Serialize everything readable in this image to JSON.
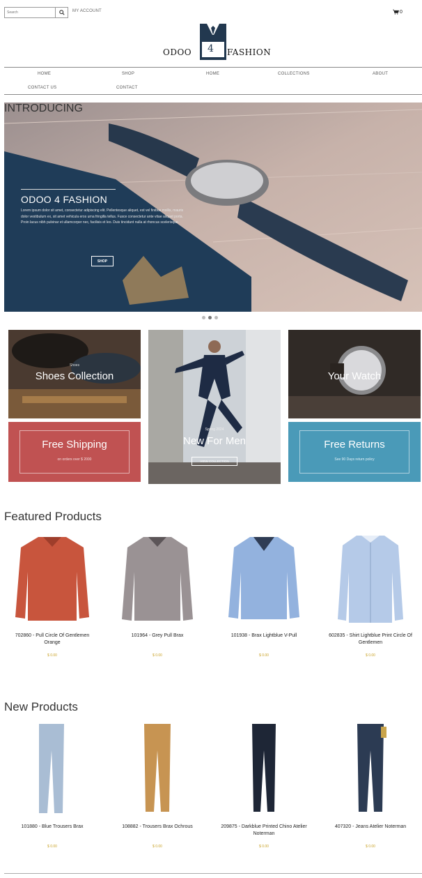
{
  "header": {
    "search_placeholder": "Search",
    "account_label": "MY ACCOUNT",
    "cart_count": "0"
  },
  "logo": {
    "left": "ODOO",
    "middle": "4",
    "right": "FASHION"
  },
  "nav": {
    "items": [
      "HOME",
      "SHOP",
      "HOME",
      "COLLECTIONS",
      "ABOUT",
      "CONTACT US",
      "CONTACT"
    ]
  },
  "hero": {
    "intro": "INTRODUCING",
    "title": "ODOO 4 FASHION",
    "body": "Lorem ipsum dolor sit amet, consectetur adipiscing elit. Pellentesque aliquet, est vel finibus mollis, mauris dolor vestibulum ex, sit amet vehicula eros urna fringilla tellus. Fusce consectetur ante vitae aliquet porta. Proin lacus nibh pulvinar et ullamcorper nec, facilisis et leo. Duis tincidunt nulla at rhoncus scelerisque.",
    "button": "SHOP"
  },
  "tiles": {
    "shoes": {
      "small": "Shoes",
      "title": "Shoes Collection"
    },
    "men": {
      "small": "Spring 2024",
      "title": "New For Men",
      "button": "VIEW COLLECTION"
    },
    "watch": {
      "title": "Your Watch"
    },
    "shipping": {
      "title": "Free Shipping",
      "sub": "on orders over $ 2000"
    },
    "returns": {
      "title": "Free Returns",
      "sub": "See 90 Days return policy"
    }
  },
  "featured": {
    "title": "Featured Products",
    "products": [
      {
        "name": "702860 - Pull Circle Of Gentlemen Orange",
        "price": "$ 0.00",
        "color": "#c8553d"
      },
      {
        "name": "101964 - Grey Pull Brax",
        "price": "$ 0.00",
        "color": "#9a9294"
      },
      {
        "name": "101938 - Brax Lightblue V-Pull",
        "price": "$ 0.00",
        "color": "#93b2de"
      },
      {
        "name": "602835 - Shirt Lightblue Print Circle Of Gentlemen",
        "price": "$ 0.00",
        "color": "#b5cae8"
      }
    ]
  },
  "newp": {
    "title": "New Products",
    "products": [
      {
        "name": "101880 - Blue Trousers Brax",
        "price": "$ 0.00",
        "color": "#a9bdd4"
      },
      {
        "name": "108882 - Trousers Brax Ochrous",
        "price": "$ 0.00",
        "color": "#c79452"
      },
      {
        "name": "209875 - Darkblue Printed Chino Atelier Noterman",
        "price": "$ 0.00",
        "color": "#1e2636"
      },
      {
        "name": "407320 - Jeans Atelier Noterman",
        "price": "$ 0.00",
        "color": "#2c3b53"
      }
    ]
  },
  "colors": {
    "shipping_red": "#c05252",
    "returns_blue": "#4a9ab8",
    "navy": "#22384f",
    "price_gold": "#c9a227"
  }
}
